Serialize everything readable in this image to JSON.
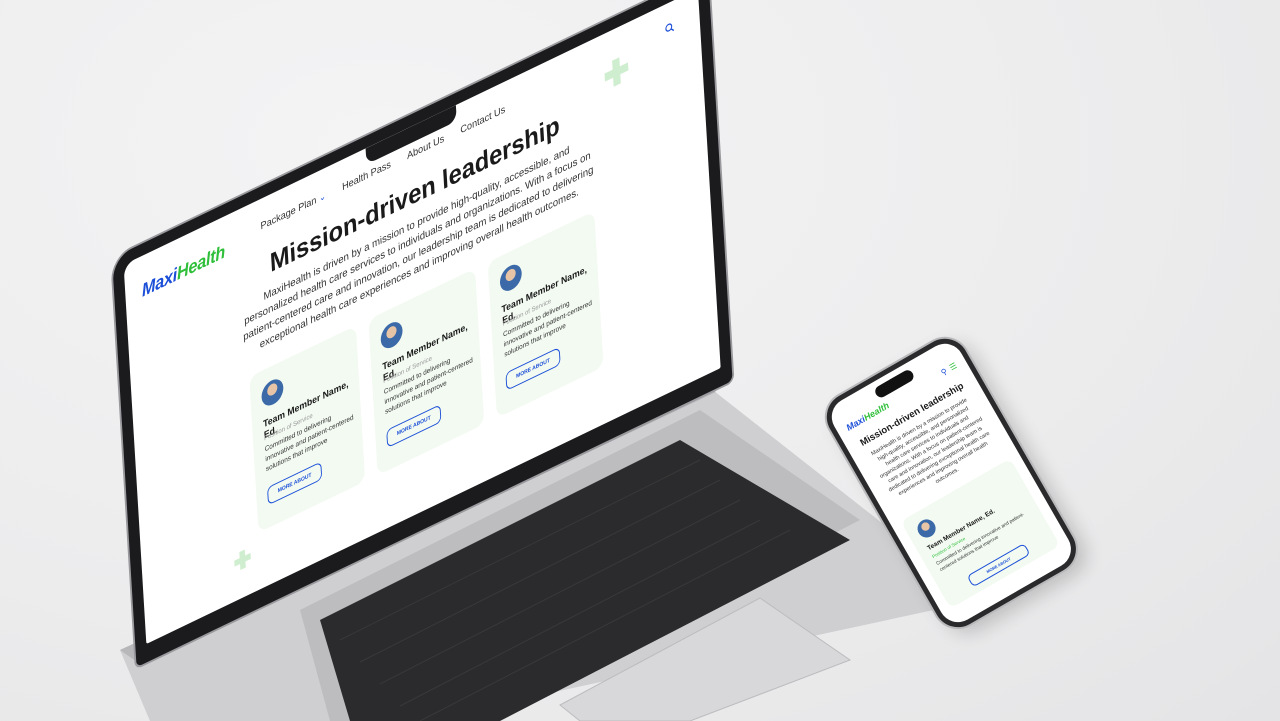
{
  "site": {
    "logo": {
      "part1": "Maxi",
      "part2": "Health"
    },
    "nav": [
      "Package Plan",
      "Health Pass",
      "About Us",
      "Contact Us"
    ],
    "hero": {
      "title": "Mission-driven leadership",
      "description": "MaxiHealth is driven by a mission to provide high-quality, accessible, and personalized health care services to individuals and organizations. With a focus on patient-centered care and innovation, our leadership team is dedicated to delivering exceptional health care experiences and improving overall health outcomes."
    },
    "cards": [
      {
        "name": "Team Member Name, Ed.",
        "position": "Position of Service",
        "description": "Committed to delivering innovative and patient-centered solutions that improve",
        "button": "MORE ABOUT"
      },
      {
        "name": "Team Member Name, Ed.",
        "position": "Position of Service",
        "description": "Committed to delivering innovative and patient-centered solutions that improve",
        "button": "MORE ABOUT"
      },
      {
        "name": "Team Member Name, Ed.",
        "position": "Position of Service",
        "description": "Committed to delivering innovative and patient-centered solutions that improve",
        "button": "MORE ABOUT"
      }
    ]
  },
  "phone": {
    "logo": {
      "part1": "Maxi",
      "part2": "Health"
    },
    "title": "Mission-driven leadership",
    "description": "MaxiHealth is driven by a mission to provide high-quality, accessible, and personalized health care services to individuals and organizations. With a focus on patient-centered care and innovation, our leadership team is dedicated to delivering exceptional health care experiences and improving overall health outcomes.",
    "card": {
      "name": "Team Member Name, Ed.",
      "position": "Position of Service",
      "description": "Committed to delivering innovative and patient-centered solutions that improve",
      "button": "MORE ABOUT"
    }
  },
  "colors": {
    "brand_blue": "#1c4fd8",
    "brand_green": "#2fbf3a",
    "card_bg": "#f2faf1"
  },
  "icons": [
    "search-icon",
    "chevron-down-icon",
    "menu-icon",
    "avatar"
  ]
}
